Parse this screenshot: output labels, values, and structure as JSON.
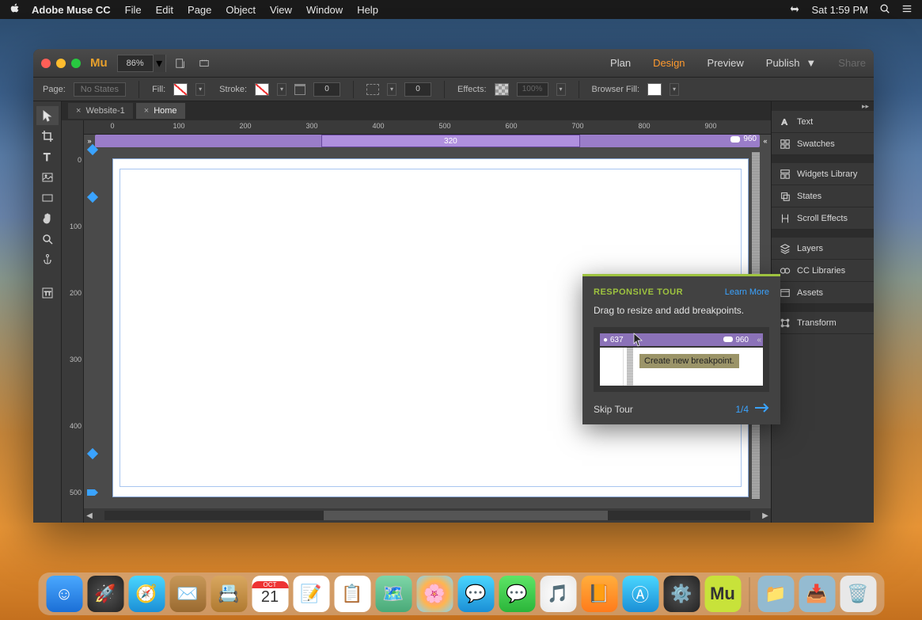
{
  "menubar": {
    "appname": "Adobe Muse CC",
    "items": [
      "File",
      "Edit",
      "Page",
      "Object",
      "View",
      "Window",
      "Help"
    ],
    "clock": "Sat 1:59 PM"
  },
  "titlebar": {
    "mu": "Mu",
    "zoom": "86%",
    "modes": {
      "plan": "Plan",
      "design": "Design",
      "preview": "Preview",
      "publish": "Publish",
      "share": "Share"
    }
  },
  "optbar": {
    "page_lbl": "Page:",
    "page_val": "No States",
    "fill_lbl": "Fill:",
    "stroke_lbl": "Stroke:",
    "stroke_val": "0",
    "corner_val": "0",
    "effects_lbl": "Effects:",
    "effects_val": "100%",
    "browserfill_lbl": "Browser Fill:"
  },
  "tabs": {
    "t1": "Website-1",
    "t2": "Home"
  },
  "ruler": {
    "h": [
      "0",
      "100",
      "200",
      "300",
      "400",
      "500",
      "600",
      "700",
      "800",
      "900"
    ],
    "v": [
      "0",
      "100",
      "200",
      "300",
      "400",
      "500"
    ]
  },
  "bp": {
    "w320": "320",
    "w960": "960"
  },
  "panels": [
    "Text",
    "Swatches",
    "Widgets Library",
    "States",
    "Scroll Effects",
    "Layers",
    "CC Libraries",
    "Assets",
    "Transform"
  ],
  "tour": {
    "title": "RESPONSIVE TOUR",
    "learn": "Learn More",
    "msg": "Drag to resize and add breakpoints.",
    "d637": "637",
    "d960": "960",
    "tip": "Create new breakpoint.",
    "skip": "Skip Tour",
    "page": "1/4"
  },
  "dock": [
    "Finder",
    "Launchpad",
    "Safari",
    "Mail",
    "Contacts",
    "Calendar",
    "Notes",
    "Reminders",
    "Maps",
    "Photos",
    "Messages",
    "iMessage",
    "iTunes",
    "iBooks",
    "App Store",
    "Preferences",
    "Muse",
    "Apps",
    "Downloads",
    "Trash"
  ]
}
